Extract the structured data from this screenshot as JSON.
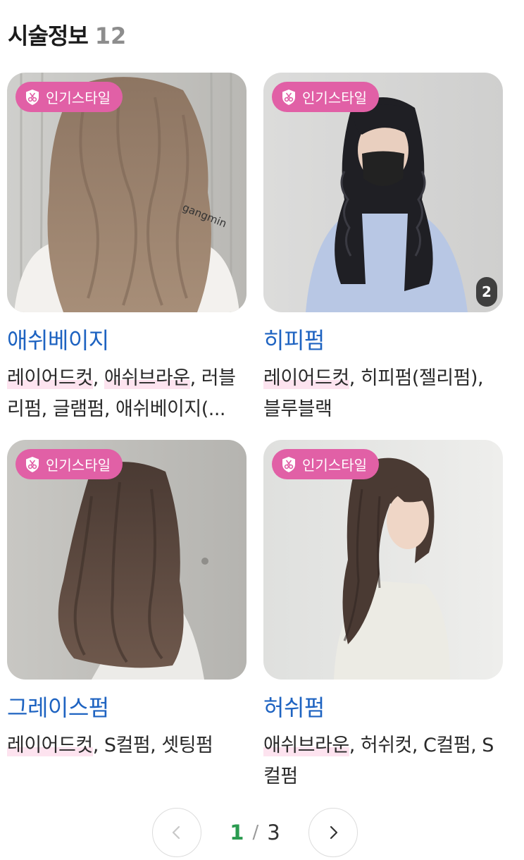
{
  "header": {
    "title": "시술정보",
    "count": "12"
  },
  "cards": [
    {
      "badge": "인기스타일",
      "name": "애쉬베이지",
      "watermark": "gangmin",
      "photo_count": "",
      "tags": [
        {
          "text": "레이어드컷",
          "highlight": true
        },
        {
          "text": ", ",
          "highlight": false
        },
        {
          "text": "애쉬브라운",
          "highlight": true
        },
        {
          "text": ", 러블리펌, 글램펌, 애쉬베이지(...",
          "highlight": false
        }
      ]
    },
    {
      "badge": "인기스타일",
      "name": "히피펌",
      "photo_count": "2",
      "tags": [
        {
          "text": "레이어드컷",
          "highlight": true
        },
        {
          "text": ", 히피펌(젤리펌), 블루블랙",
          "highlight": false
        }
      ]
    },
    {
      "badge": "인기스타일",
      "name": "그레이스펌",
      "photo_count": "",
      "tags": [
        {
          "text": "레이어드컷",
          "highlight": true
        },
        {
          "text": ", S컬펌, 셋팅펌",
          "highlight": false
        }
      ]
    },
    {
      "badge": "인기스타일",
      "name": "허쉬펌",
      "photo_count": "",
      "tags": [
        {
          "text": "애쉬브라운",
          "highlight": true
        },
        {
          "text": ", 허쉬컷, C컬펌, S컬펌",
          "highlight": false
        }
      ]
    }
  ],
  "pagination": {
    "current": "1",
    "separator": "/",
    "total": "3"
  },
  "icons": {
    "badge": "scissors-shield-icon",
    "prev": "chevron-left-icon",
    "next": "chevron-right-icon"
  },
  "colors": {
    "badge_bg": "#e160a6",
    "style_name": "#1e63c1",
    "current_page": "#2b9b50",
    "tag_highlight": "#fde3ef"
  }
}
